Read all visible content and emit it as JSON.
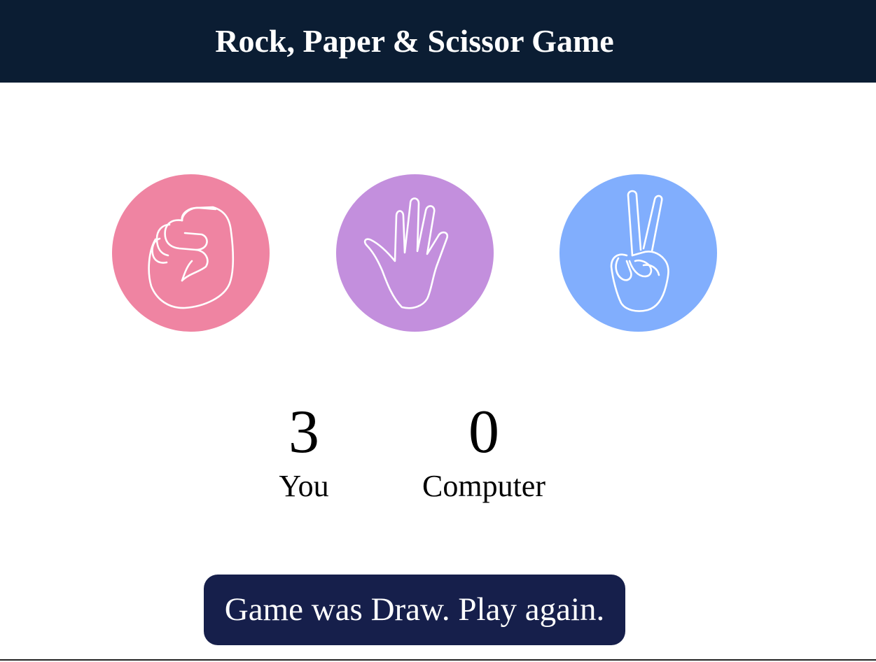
{
  "header": {
    "title": "Rock, Paper & Scissor Game"
  },
  "choices": [
    {
      "id": "rock",
      "icon": "fist-icon",
      "color": "#ef84a2"
    },
    {
      "id": "paper",
      "icon": "open-hand-icon",
      "color": "#c38fdd"
    },
    {
      "id": "scissors",
      "icon": "peace-hand-icon",
      "color": "#81aefd"
    }
  ],
  "scoreboard": {
    "user_score": "3",
    "user_label": "You",
    "computer_score": "0",
    "computer_label": "Computer"
  },
  "message": {
    "text": "Game was Draw. Play again."
  },
  "colors": {
    "header_bg": "#0b1d33",
    "message_bg": "#161f4b"
  }
}
